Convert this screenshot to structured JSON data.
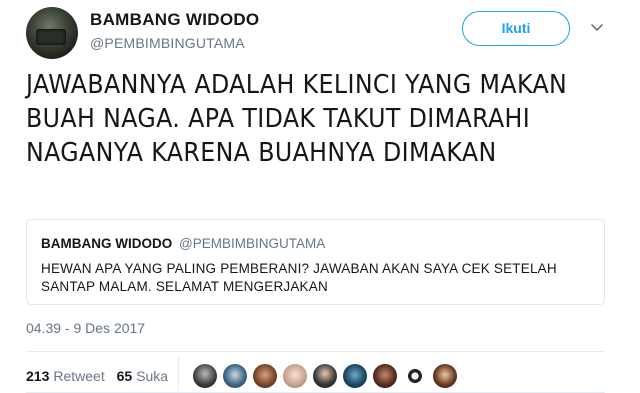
{
  "author": {
    "display_name": "BAMBANG WIDODO",
    "handle": "@PEMBIMBINGUTAMA"
  },
  "actions": {
    "follow_label": "Ikuti"
  },
  "tweet": {
    "text": "JAWABANNYA ADALAH KELINCI YANG MAKAN BUAH NAGA. APA TIDAK TAKUT DIMARAHI NAGANYA KARENA BUAHNYA DIMAKAN",
    "timestamp": "04.39 - 9 Des 2017"
  },
  "quoted_tweet": {
    "display_name": "BAMBANG WIDODO",
    "handle": "@PEMBIMBINGUTAMA",
    "text": "HEWAN APA YANG PALING PEMBERANI? JAWABAN AKAN SAYA CEK SETELAH SANTAP MALAM. SELAMAT MENGERJAKAN"
  },
  "stats": {
    "retweets_count": "213",
    "retweets_label": "Retweet",
    "likes_count": "65",
    "likes_label": "Suka"
  },
  "colors": {
    "accent": "#1da1f2",
    "secondary_text": "#657786",
    "border": "#e1e8ed"
  },
  "icons": {
    "menu": "chevron-down-icon"
  }
}
